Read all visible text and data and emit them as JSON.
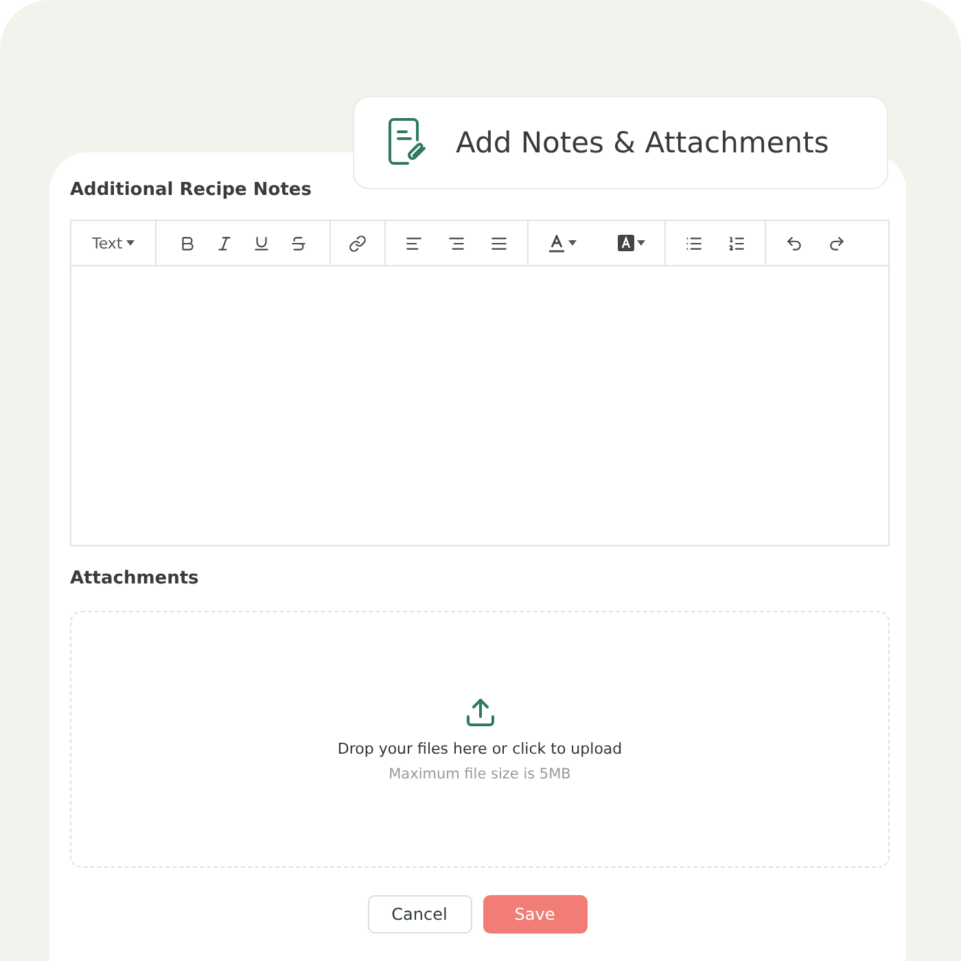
{
  "header": {
    "title": "Add Notes & Attachments"
  },
  "notes": {
    "label": "Additional Recipe Notes",
    "text_style": "Text"
  },
  "attachments": {
    "label": "Attachments",
    "prompt": "Drop your files here or click to upload",
    "hint": "Maximum file size is 5MB"
  },
  "buttons": [
    {
      "kind": "secondary",
      "label": "Cancel"
    },
    {
      "kind": "primary",
      "label": "Save"
    }
  ]
}
